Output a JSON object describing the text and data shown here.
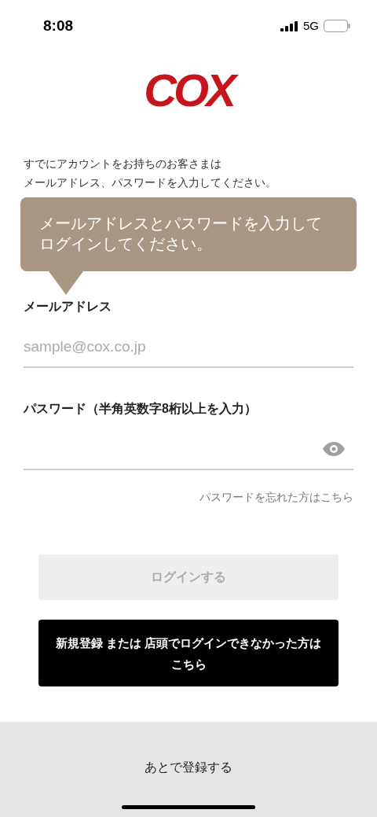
{
  "status_bar": {
    "time": "8:08",
    "network": "5G"
  },
  "logo": "COX",
  "intro": [
    "すでにアカウントをお持ちのお客さまは",
    "メールアドレス、パスワードを入力してください。"
  ],
  "tooltip": "メールアドレスとパスワードを入力してログインしてください。",
  "email": {
    "label": "メールアドレス",
    "placeholder": "sample@cox.co.jp"
  },
  "password": {
    "label": "パスワード（半角英数字8桁以上を入力）"
  },
  "forgot_link": "パスワードを忘れた方はこちら",
  "login_button": {
    "label": "ログインする",
    "disabled": true
  },
  "register_button": "新規登録 または 店頭でログインできなかった方はこちら",
  "later_button": "あとで登録する"
}
